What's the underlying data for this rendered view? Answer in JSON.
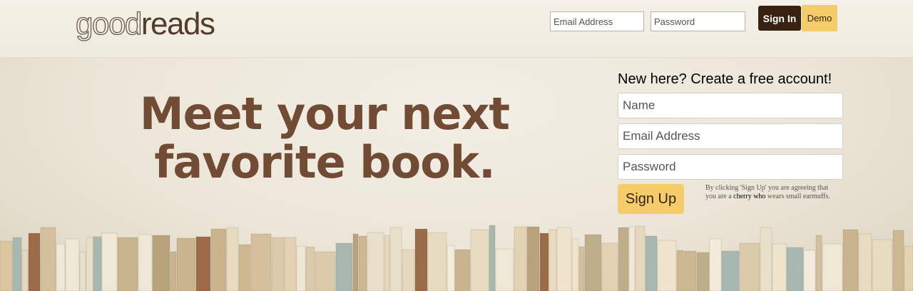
{
  "header": {
    "logo_light": "good",
    "logo_dark": "reads",
    "email_placeholder": "Email Address",
    "password_placeholder": "Password",
    "signin_label": "Sign In",
    "demo_label": "Demo"
  },
  "hero": {
    "headline_line1": "Meet your next",
    "headline_line2": "favorite book."
  },
  "signup_form": {
    "title": "New here? Create a free account!",
    "name_placeholder": "Name",
    "email_placeholder": "Email Address",
    "password_placeholder": "Password",
    "submit_label": "Sign Up",
    "terms_prefix": "By clicking 'Sign Up' you are agreeing that you are a ",
    "terms_link": "cherry who",
    "terms_suffix": " wears small earmuffs."
  },
  "colors": {
    "brand_dark": "#382110",
    "accent_yellow": "#f4cd6a",
    "headline_brown": "#714b34"
  }
}
